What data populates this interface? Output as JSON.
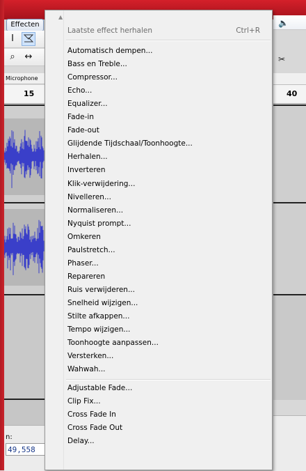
{
  "toolbar": {
    "effecten_label": "Effecten"
  },
  "device": {
    "input_label": "Microphone"
  },
  "ruler": {
    "left_tick": "15",
    "right_tick": "40"
  },
  "selection": {
    "label": "n:",
    "value": "49,558"
  },
  "menu": {
    "repeat_label": "Laatste effect herhalen",
    "repeat_shortcut": "Ctrl+R",
    "group1": [
      "Automatisch dempen...",
      "Bass en Treble...",
      "Compressor...",
      "Echo...",
      "Equalizer...",
      "Fade-in",
      "Fade-out",
      "Glijdende Tijdschaal/Toonhoogte...",
      "Herhalen...",
      "Inverteren",
      "Klik-verwijdering...",
      "Nivelleren...",
      "Normaliseren...",
      "Nyquist prompt...",
      "Omkeren",
      "Paulstretch...",
      "Phaser...",
      "Repareren",
      "Ruis verwijderen...",
      "Snelheid wijzigen...",
      "Stilte afkappen...",
      "Tempo wijzigen...",
      "Toonhoogte aanpassen...",
      "Versterken...",
      "Wahwah..."
    ],
    "group2": [
      "Adjustable Fade...",
      "Clip Fix...",
      "Cross Fade In",
      "Cross Fade Out",
      "Delay..."
    ]
  },
  "colors": {
    "waveform": "#3a3fc9",
    "title_bar": "#c11d26",
    "menu_bg": "#f0f0f0"
  }
}
